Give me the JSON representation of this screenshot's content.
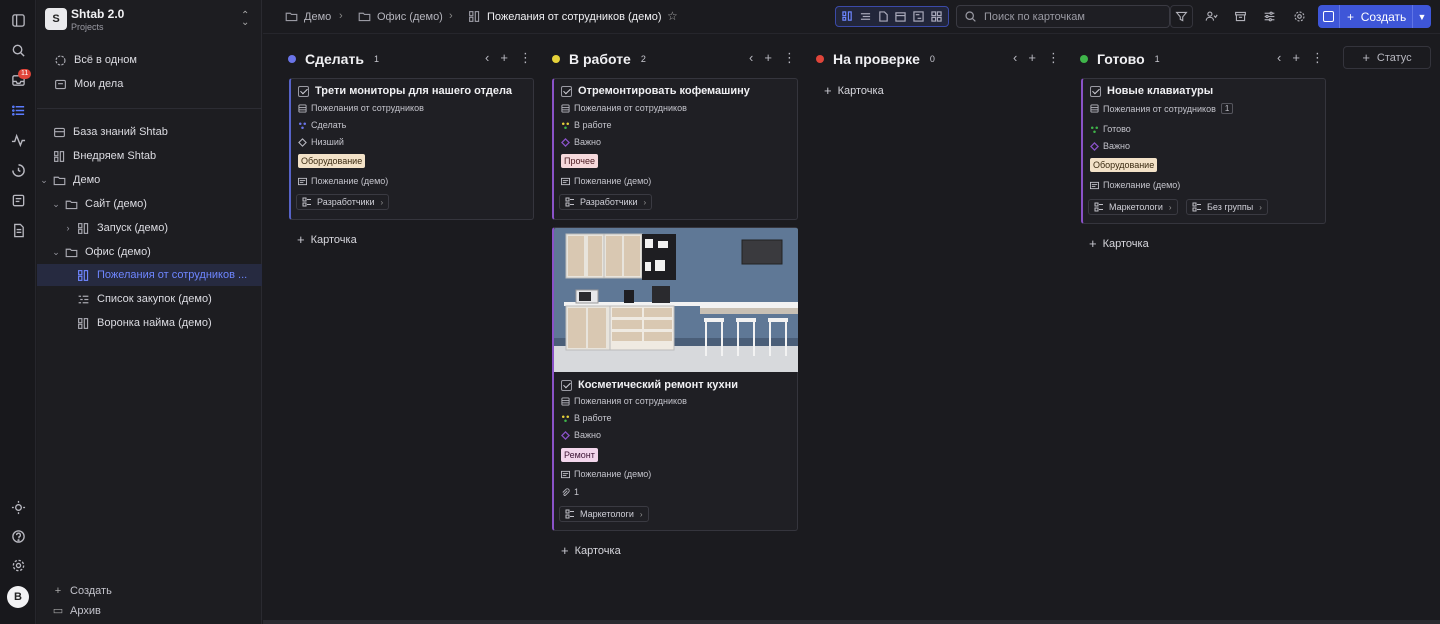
{
  "rail": {
    "notification_count": "11",
    "avatar_initial": "B"
  },
  "workspace": {
    "logo_letter": "S",
    "name": "Shtab 2.0",
    "subtitle": "Projects"
  },
  "sidebar": {
    "top_items": [
      {
        "label": "Всё в одном",
        "icon": "target-icon"
      },
      {
        "label": "Мои дела",
        "icon": "inbox-icon"
      }
    ],
    "tree": [
      {
        "label": "База знаний Shtab",
        "icon": "book-icon"
      },
      {
        "label": "Внедряем Shtab",
        "icon": "board-icon"
      },
      {
        "label": "Демо",
        "icon": "folder-icon",
        "expanded": true
      },
      {
        "label": "Сайт (демо)",
        "icon": "folder-icon",
        "expanded": true
      },
      {
        "label": "Запуск (демо)",
        "icon": "board-icon",
        "collapsed": true
      },
      {
        "label": "Офис (демо)",
        "icon": "folder-icon",
        "expanded": true
      },
      {
        "label": "Пожелания от сотрудников ...",
        "icon": "board-icon",
        "selected": true
      },
      {
        "label": "Список закупок (демо)",
        "icon": "list-icon"
      },
      {
        "label": "Воронка найма (демо)",
        "icon": "board-icon"
      }
    ],
    "footer": {
      "create": "Создать",
      "archive": "Архив"
    }
  },
  "breadcrumb": [
    {
      "label": "Демо",
      "icon": "folder-icon"
    },
    {
      "label": "Офис (демо)",
      "icon": "folder-icon"
    },
    {
      "label": "Пожелания от сотрудников (демо)",
      "icon": "board-icon"
    }
  ],
  "toolbar": {
    "search_placeholder": "Поиск по карточкам",
    "create_label": "Создать"
  },
  "board": {
    "add_card_label": "Карточка",
    "add_status_label": "Статус",
    "columns": [
      {
        "name": "Сделать",
        "count": "1",
        "color": "#6a74e8"
      },
      {
        "name": "В работе",
        "count": "2",
        "color": "#e6d23a"
      },
      {
        "name": "На проверке",
        "count": "0",
        "color": "#e0453a"
      },
      {
        "name": "Готово",
        "count": "1",
        "color": "#3fb54a"
      }
    ],
    "cards": {
      "c1": {
        "title": "Трети мониторы для нашего отдела",
        "board": "Пожелания от сотрудников",
        "status": "Сделать",
        "priority": "Низший",
        "tag": "Оборудование",
        "type": "Пожелание (демо)",
        "groups": [
          "Разработчики"
        ]
      },
      "c2": {
        "title": "Отремонтировать кофемашину",
        "board": "Пожелания от сотрудников",
        "status": "В работе",
        "priority": "Важно",
        "tag": "Прочее",
        "type": "Пожелание (демо)",
        "groups": [
          "Разработчики"
        ]
      },
      "c3": {
        "title": "Косметический ремонт кухни",
        "board": "Пожелания от сотрудников",
        "status": "В работе",
        "priority": "Важно",
        "tag": "Ремонт",
        "type": "Пожелание (демо)",
        "attachments": "1",
        "groups": [
          "Маркетологи"
        ]
      },
      "c4": {
        "title": "Новые клавиатуры",
        "board": "Пожелания от сотрудников",
        "board_count": "1",
        "status": "Готово",
        "priority": "Важно",
        "tag": "Оборудование",
        "type": "Пожелание (демо)",
        "groups": [
          "Маркетологи",
          "Без группы"
        ]
      }
    },
    "tag_colors": {
      "Оборудование": "#f3e2c8",
      "Прочее": "#f6d9dc",
      "Ремонт": "#f2d6ec"
    }
  }
}
